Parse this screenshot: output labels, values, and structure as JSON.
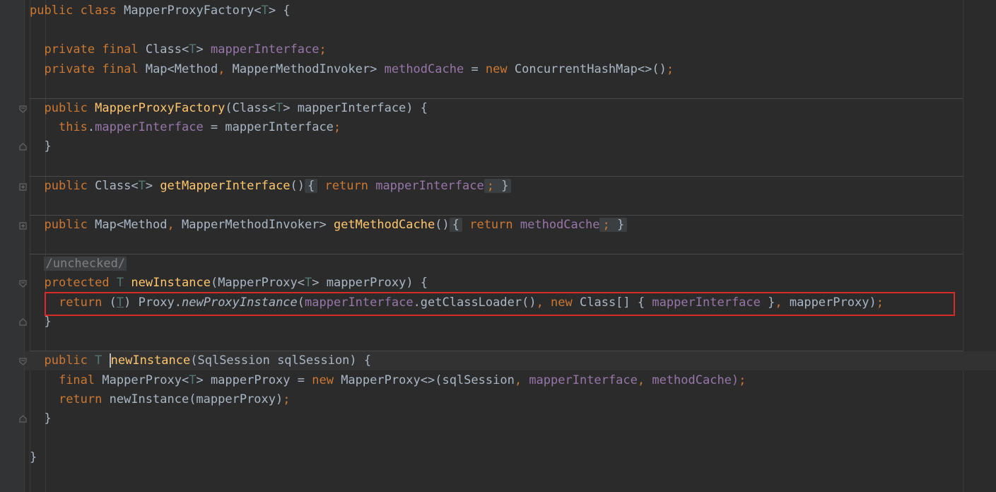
{
  "editor": {
    "lines": {
      "l1": {
        "a": "public",
        "b": "class",
        "c": "MapperProxyFactory<",
        "d": "T",
        "e": "> {"
      },
      "l3": {
        "a": "private",
        "b": "final",
        "c": "Class<",
        "d": "T",
        "e": "> ",
        "f": "mapperInterface",
        "g": ";"
      },
      "l4": {
        "a": "private",
        "b": "final",
        "c": "Map<Method",
        "d": ", ",
        "e": "MapperMethodInvoker> ",
        "f": "methodCache",
        "g": " = ",
        "h": "new",
        "i": " ConcurrentHashMap<>()",
        "j": ";"
      },
      "l6": {
        "a": "public",
        "b": "MapperProxyFactory",
        "c": "(Class<",
        "d": "T",
        "e": "> mapperInterface) {"
      },
      "l7": {
        "a": "this",
        "b": ".",
        "c": "mapperInterface",
        "d": " = mapperInterface",
        "e": ";"
      },
      "l8": {
        "a": "}"
      },
      "l10": {
        "a": "public",
        "b": "Class<",
        "c": "T",
        "d": "> ",
        "e": "getMapperInterface",
        "f": "()",
        "g": "{",
        "h": "return",
        "i": "mapperInterface",
        "j": ";",
        "k": "}"
      },
      "l12": {
        "a": "public",
        "b": "Map<Method",
        "c": ", ",
        "d": "MapperMethodInvoker> ",
        "e": "getMethodCache",
        "f": "()",
        "g": "{",
        "h": "return",
        "i": "methodCache",
        "j": ";",
        "k": "}"
      },
      "l14": {
        "a": "/unchecked/"
      },
      "l15": {
        "a": "protected",
        "b": "T",
        "c": "newInstance",
        "d": "(MapperProxy<",
        "e": "T",
        "f": "> mapperProxy) {"
      },
      "l16": {
        "a": "return",
        "b": "(",
        "c": "T",
        "d": ") Proxy.",
        "e": "newProxyInstance",
        "f": "(",
        "g": "mapperInterface",
        "h": ".getClassLoader()",
        "i": ", ",
        "j": "new",
        "k": " Class[] { ",
        "l": "mapperInterface",
        "m": " }",
        "n": ", ",
        "o": "mapperProxy)",
        "p": ";"
      },
      "l17": {
        "a": "}"
      },
      "l19": {
        "a": "public",
        "b": "T",
        "c": "newInstance",
        "d": "(SqlSession sqlSession) {"
      },
      "l20": {
        "a": "final",
        "b": "MapperProxy<",
        "c": "T",
        "d": "> mapperProxy = ",
        "e": "new",
        "f": " MapperProxy<>(sqlSession",
        "g": ", ",
        "h": "mapperInterface",
        "i": ", ",
        "j": "methodCache)",
        "k": ";"
      },
      "l21": {
        "a": "return",
        "b": " newInstance(mapperProxy)",
        "c": ";"
      },
      "l22": {
        "a": "}"
      },
      "l24": {
        "a": "}"
      }
    }
  },
  "colors": {
    "background": "#2b2b2b",
    "keyword": "#cc7832",
    "field": "#9876aa",
    "type_param": "#507874",
    "method_decl": "#ffc66d",
    "text": "#a9b7c6",
    "highlight_box": "#d92a2a"
  },
  "icons": [
    "fold-collapse-icon",
    "fold-end-icon",
    "fold-expand-icon"
  ]
}
